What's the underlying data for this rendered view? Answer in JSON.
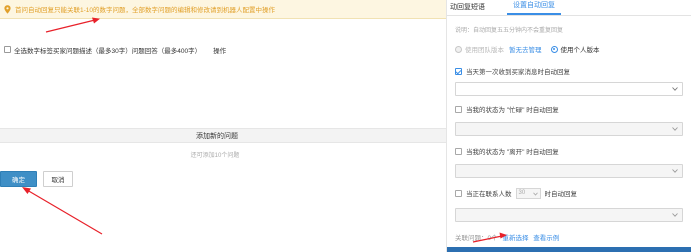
{
  "left": {
    "warning": "首问自动回复只能关联1-10的数字问题，全部数字问题的编辑和修改请到机器人配置中操作",
    "question_header": {
      "col_question": "全选数字标签买家问题描述（最多30字）问题回答（最多400字）",
      "col_ops": "操作"
    },
    "add_question": "添加新的问题",
    "add_hint": "还可添加10个问题",
    "buttons": {
      "confirm": "确定",
      "cancel": "取消"
    }
  },
  "right": {
    "tabs": [
      "动回复短语",
      "设置自动回复"
    ],
    "active_tab": 1,
    "note": "说明：自动回复五五分钟内不会重复回复",
    "radio": {
      "team_version": "使用团队版本",
      "manage_link": "暂无去管理",
      "personal_version": "使用个人版本"
    },
    "options": [
      {
        "label": "当天第一次收到买家消息时自动回复",
        "checked": true
      },
      {
        "label": "当我的状态为 \"忙碌\" 时自动回复",
        "checked": false
      },
      {
        "label": "当我的状态为 \"离开\" 时自动回复",
        "checked": false
      }
    ],
    "concurrent": {
      "prefix": "当正在联系人数",
      "value": "30",
      "suffix": "时自动回复"
    },
    "footer": {
      "label": "关联问题：0个",
      "reselect": "重新选择",
      "view_example": "查看示例"
    }
  },
  "colors": {
    "accent": "#3a8ee6",
    "confirm_button": "#3f8fc6",
    "warning_text": "#e1a02a",
    "warning_bg": "#fdf6e1",
    "annotation_arrow": "#e8212a"
  }
}
